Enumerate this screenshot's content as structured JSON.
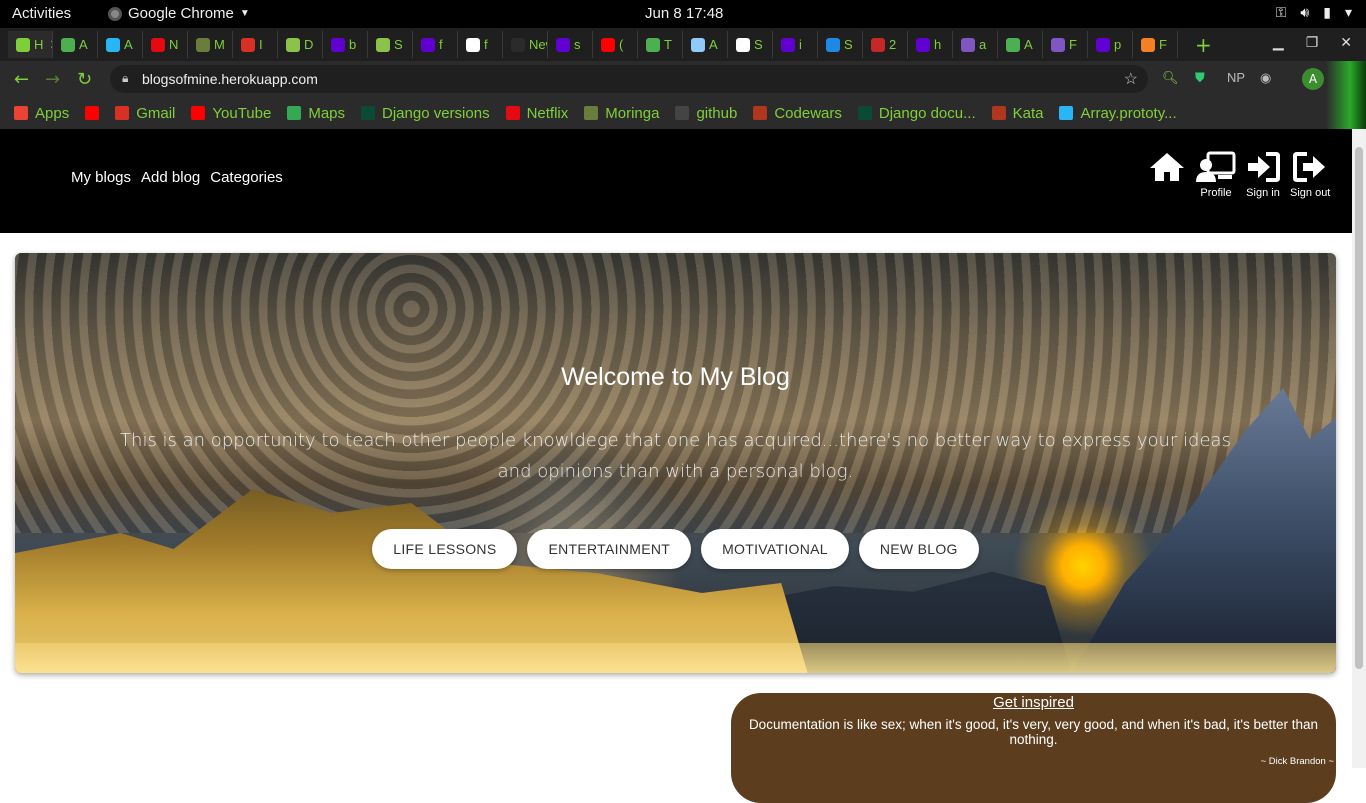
{
  "system": {
    "activities": "Activities",
    "app_name": "Google Chrome",
    "clock": "Jun 8  17:48"
  },
  "browser": {
    "tabs": [
      {
        "label": "H",
        "color": "#7fcf3a"
      },
      {
        "label": "A",
        "color": "#4caf50"
      },
      {
        "label": "A",
        "color": "#29b6f6"
      },
      {
        "label": "N",
        "color": "#e50914"
      },
      {
        "label": "M",
        "color": "#6b7d3a"
      },
      {
        "label": "I",
        "color": "#d93025"
      },
      {
        "label": "D",
        "color": "#8bc34a"
      },
      {
        "label": "b",
        "color": "#6001d2"
      },
      {
        "label": "S",
        "color": "#8bc34a"
      },
      {
        "label": "f",
        "color": "#6001d2"
      },
      {
        "label": "f",
        "color": "#ffffff"
      },
      {
        "label": "New",
        "color": "#2b2b2b"
      },
      {
        "label": "s",
        "color": "#6001d2"
      },
      {
        "label": "(",
        "color": "#ff0000"
      },
      {
        "label": "T",
        "color": "#4caf50"
      },
      {
        "label": "A",
        "color": "#90caf9"
      },
      {
        "label": "S",
        "color": "#ffffff"
      },
      {
        "label": "i",
        "color": "#6001d2"
      },
      {
        "label": "S",
        "color": "#1e88e5"
      },
      {
        "label": "2",
        "color": "#c62828"
      },
      {
        "label": "h",
        "color": "#6001d2"
      },
      {
        "label": "a",
        "color": "#7e57c2"
      },
      {
        "label": "A",
        "color": "#4caf50"
      },
      {
        "label": "F",
        "color": "#7e57c2"
      },
      {
        "label": "p",
        "color": "#6001d2"
      },
      {
        "label": "F",
        "color": "#f48024"
      }
    ],
    "url": "blogsofmine.herokuapp.com",
    "avatar_letter": "A",
    "extension_np": "NP",
    "bookmarks": [
      {
        "label": "Apps",
        "color": "#ea4335"
      },
      {
        "label": "",
        "color": "#ff0000"
      },
      {
        "label": "Gmail",
        "color": "#d93025"
      },
      {
        "label": "YouTube",
        "color": "#ff0000"
      },
      {
        "label": "Maps",
        "color": "#34a853"
      },
      {
        "label": "Django versions",
        "color": "#0c4b33"
      },
      {
        "label": "Netflix",
        "color": "#e50914"
      },
      {
        "label": "Moringa",
        "color": "#6b7d3a"
      },
      {
        "label": "github",
        "color": "#444444"
      },
      {
        "label": "Codewars",
        "color": "#b1361e"
      },
      {
        "label": "Django docu...",
        "color": "#0c4b33"
      },
      {
        "label": "Kata",
        "color": "#b1361e"
      },
      {
        "label": "Array.prototy...",
        "color": "#29b6f6"
      }
    ]
  },
  "site": {
    "nav_links": [
      "My blogs",
      "Add blog",
      "Categories"
    ],
    "nav_icons": [
      {
        "name": "home-icon",
        "label": ""
      },
      {
        "name": "profile-icon",
        "label": "Profile"
      },
      {
        "name": "sign-in-icon",
        "label": "Sign in"
      },
      {
        "name": "sign-out-icon",
        "label": "Sign out"
      }
    ],
    "hero": {
      "title": "Welcome to My Blog",
      "text": "This is an opportunity to teach other people knowldege that one has acquired...there's no better way to express your ideas and opinions than with a personal blog.",
      "buttons": [
        "LIFE LESSONS",
        "ENTERTAINMENT",
        "MOTIVATIONAL",
        "NEW BLOG"
      ]
    },
    "quote": {
      "title": "Get inspired",
      "text": "Documentation is like sex; when it's good, it's very, very good, and when it's bad, it's better than nothing.",
      "author": "~ Dick Brandon ~",
      "background": "#5c3d1e"
    }
  }
}
